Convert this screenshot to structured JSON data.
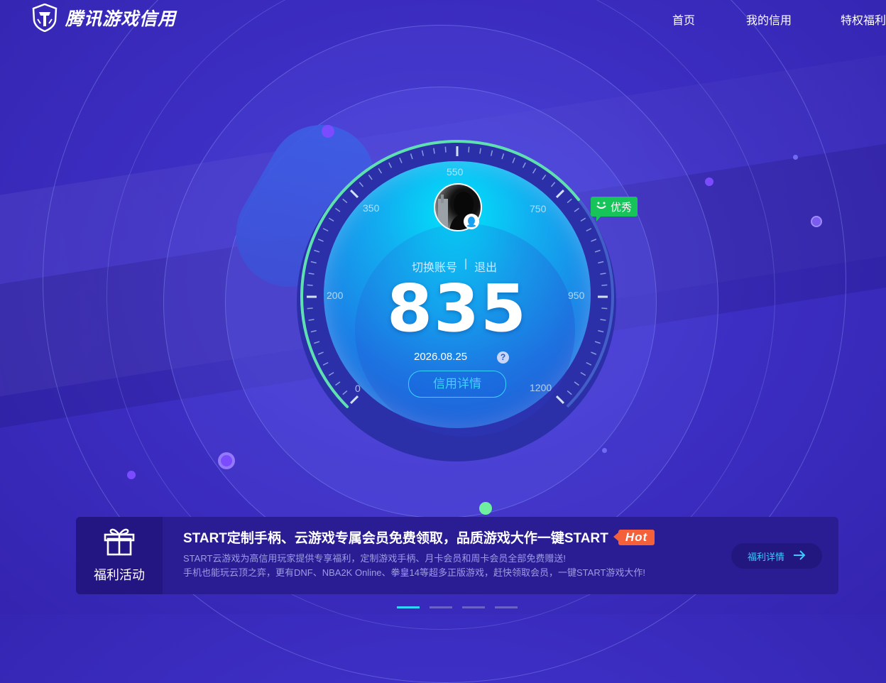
{
  "header": {
    "logo_text": "腾讯游戏信用",
    "nav": [
      {
        "label": "首页",
        "active": true
      },
      {
        "label": "我的信用",
        "active": false
      },
      {
        "label": "特权福利",
        "active": false
      }
    ]
  },
  "gauge": {
    "score": "835",
    "score_value": 835,
    "scale_min": 0,
    "scale_max": 1200,
    "tick_labels": [
      "0",
      "200",
      "350",
      "550",
      "750",
      "950",
      "1200"
    ],
    "rating": "优秀",
    "switch_account": "切换账号",
    "separator": "|",
    "logout": "退出",
    "date": "2026.08.25",
    "help": "?",
    "detail_button": "信用详情"
  },
  "banner": {
    "icon": "gift-icon",
    "side_label": "福利活动",
    "title": "START定制手柄、云游戏专属会员免费领取，品质游戏大作一键START",
    "hot": "Hot",
    "desc_line1": "START云游戏为高信用玩家提供专享福利，定制游戏手柄、月卡会员和周卡会员全部免费赠送!",
    "desc_line2": "手机也能玩云顶之弈，更有DNF、NBA2K Online、拳皇14等超多正版游戏，赶快领取会员，一键START游戏大作!",
    "button": "福利详情"
  },
  "pager": {
    "count": 4,
    "active_index": 0
  },
  "colors": {
    "background": "#3d2fc4",
    "accent": "#2fd7ff",
    "rating_green": "#17c45a",
    "hot_orange": "#f4603a",
    "active_nav": "#53c8ff"
  }
}
